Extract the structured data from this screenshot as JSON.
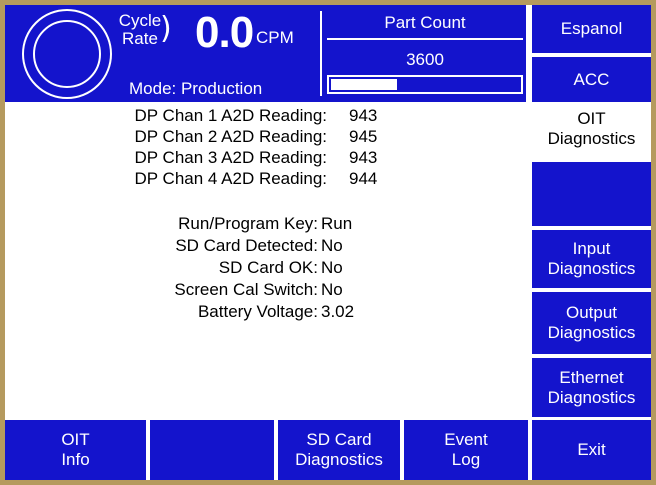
{
  "header": {
    "cycle_rate_label_line1": "Cycle",
    "cycle_rate_label_line2": "Rate",
    "rate_value": "0.0",
    "rate_unit": "CPM",
    "mode": "Mode: Production",
    "part_count_title": "Part Count",
    "part_count_value": "3600",
    "part_count_progress": 0.35
  },
  "side_buttons": {
    "language": "Espanol",
    "acc": "ACC",
    "current_line1": "OIT",
    "current_line2": "Diagnostics",
    "input_line1": "Input",
    "input_line2": "Diagnostics",
    "output_line1": "Output",
    "output_line2": "Diagnostics",
    "ethernet_line1": "Ethernet",
    "ethernet_line2": "Diagnostics"
  },
  "readings": [
    {
      "label": "DP Chan 1 A2D Reading:",
      "value": "943"
    },
    {
      "label": "DP Chan 2 A2D Reading:",
      "value": "945"
    },
    {
      "label": "DP Chan 3 A2D Reading:",
      "value": "943"
    },
    {
      "label": "DP Chan 4 A2D Reading:",
      "value": "944"
    }
  ],
  "status": [
    {
      "label": "Run/Program Key:",
      "value": "Run"
    },
    {
      "label": "SD Card Detected:",
      "value": "No"
    },
    {
      "label": "SD Card OK:",
      "value": "No"
    },
    {
      "label": "Screen Cal Switch:",
      "value": "No"
    },
    {
      "label": "Battery Voltage:",
      "value": "3.02"
    }
  ],
  "bottom_buttons": {
    "oit_info_line1": "OIT",
    "oit_info_line2": "Info",
    "sd_card_line1": "SD Card",
    "sd_card_line2": "Diagnostics",
    "event_log_line1": "Event",
    "event_log_line2": "Log",
    "exit": "Exit"
  },
  "colors": {
    "panel_blue": "#1414cc",
    "frame_tan": "#b59a5e"
  }
}
